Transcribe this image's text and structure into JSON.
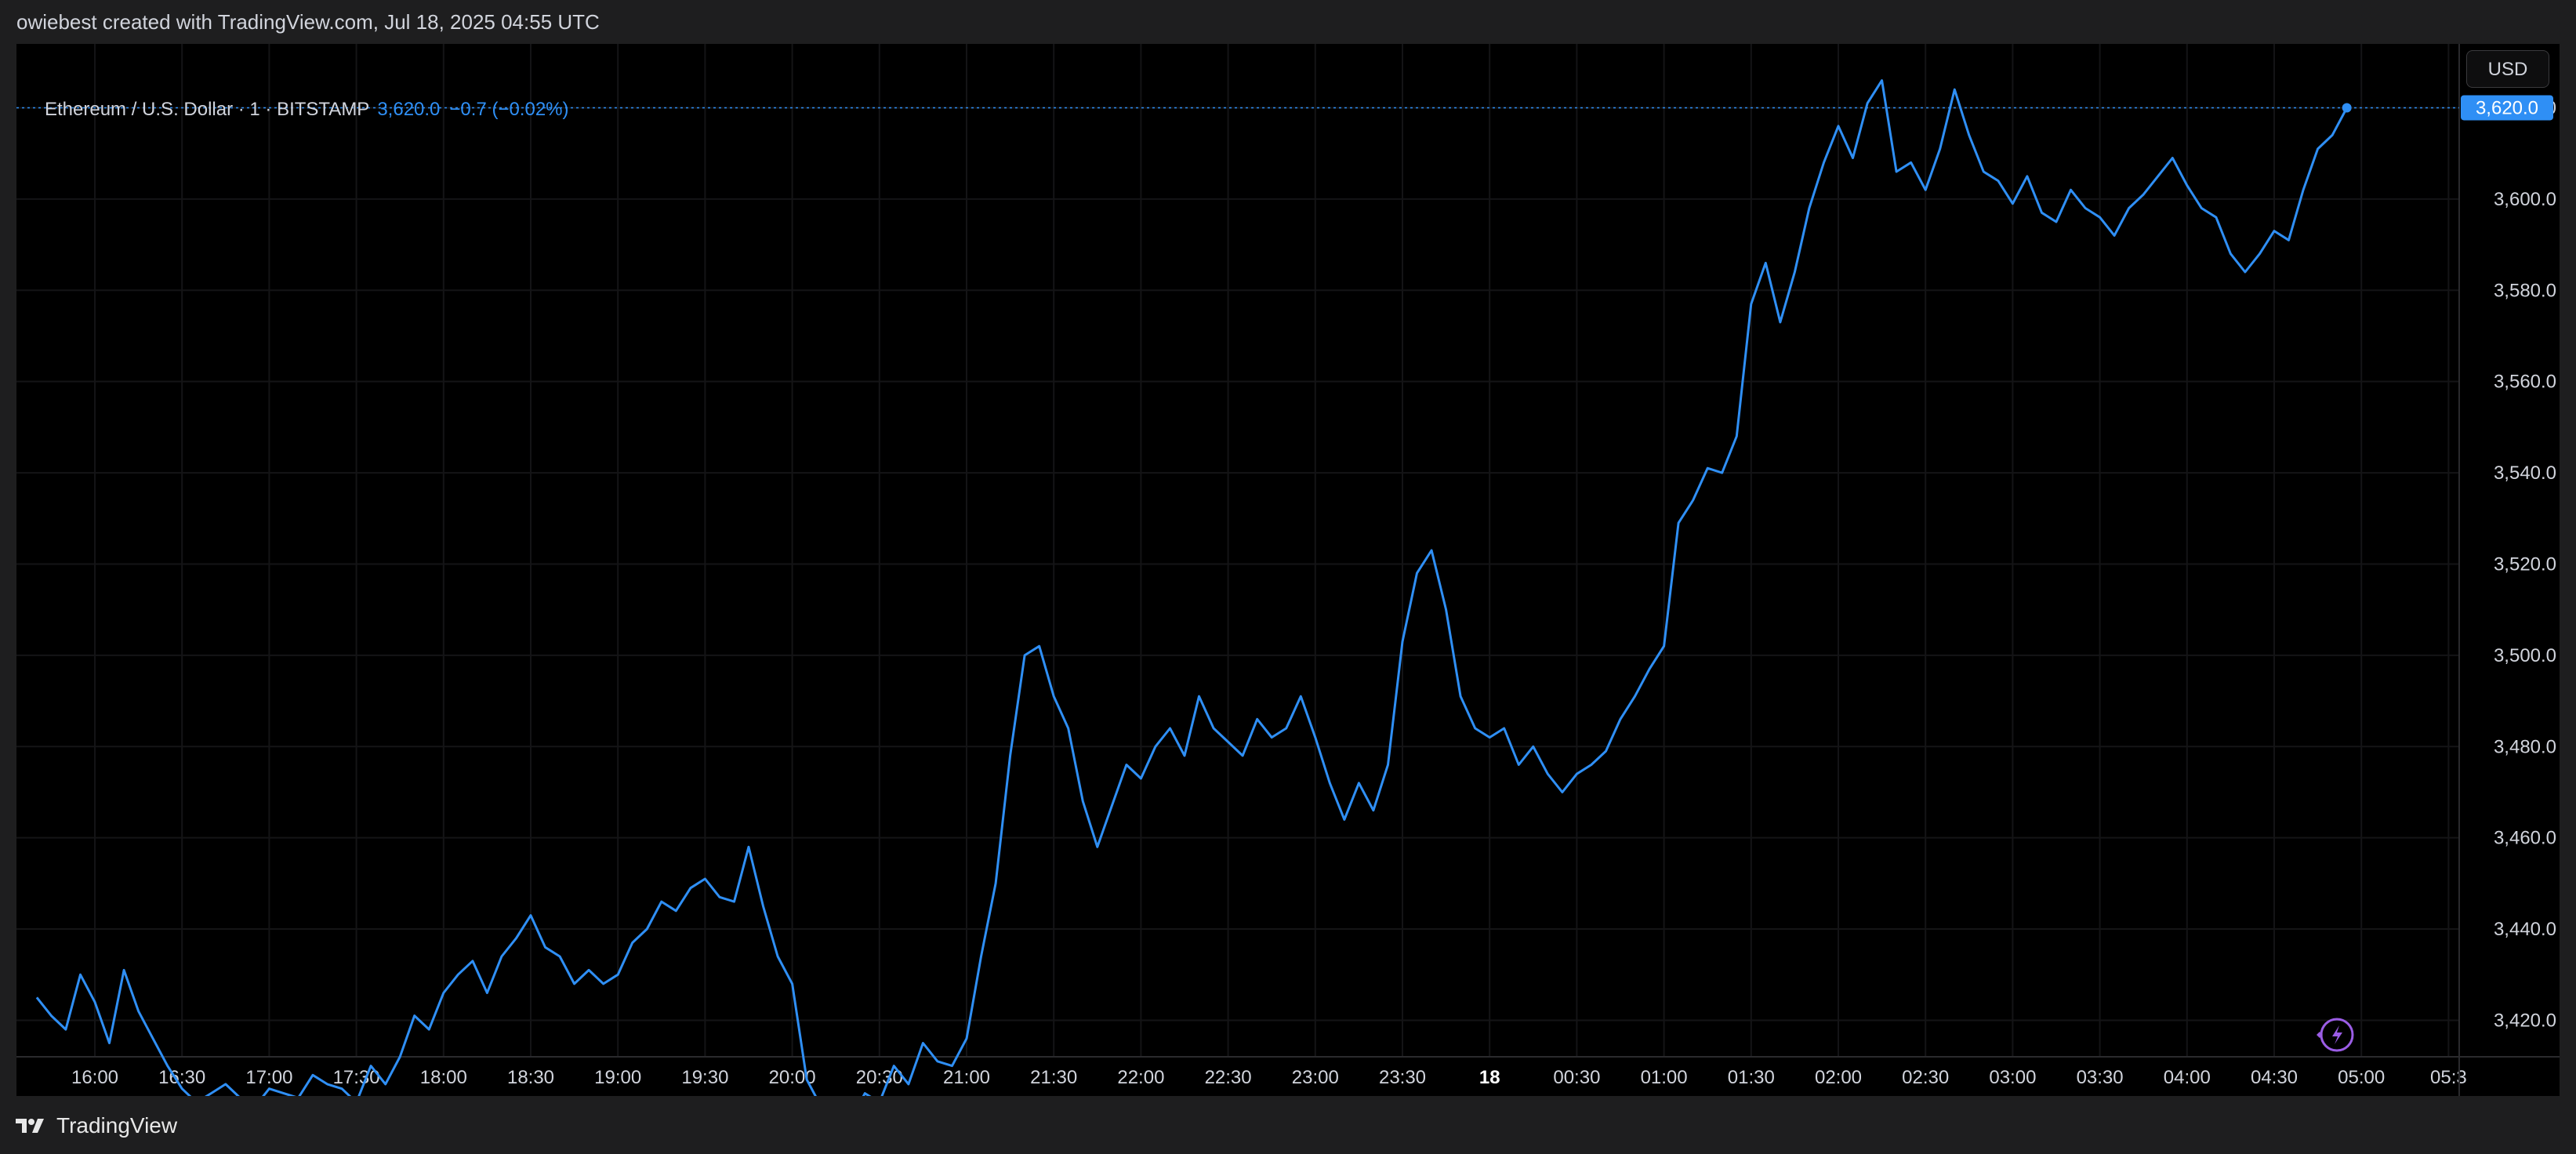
{
  "header": {
    "credit": "owiebest created with TradingView.com, Jul 18, 2025 04:55 UTC"
  },
  "legend": {
    "symbol": "Ethereum / U.S. Dollar · 1 · BITSTAMP",
    "last": "3,620.0",
    "change": "−0.7 (−0.02%)"
  },
  "currency_button": "USD",
  "footer": {
    "brand": "TradingView"
  },
  "colors": {
    "line": "#2f8ff5",
    "background": "#000000",
    "grid": "#141416",
    "text": "#d1d4dc",
    "price_tag": "#2f8ff5"
  },
  "icons": [
    "tradingview-logo-icon",
    "bolt-sparkle-icon"
  ],
  "chart_data": {
    "type": "line",
    "title": "Ethereum / U.S. Dollar · 1 · BITSTAMP",
    "series": [
      {
        "x": [
          "15:40",
          "15:45",
          "15:50",
          "15:55",
          "16:00",
          "16:05",
          "16:10",
          "16:15",
          "16:20",
          "16:25",
          "16:30",
          "16:35",
          "16:40",
          "16:45",
          "16:50",
          "16:55",
          "17:00",
          "17:05",
          "17:10",
          "17:15",
          "17:20",
          "17:25",
          "17:30",
          "17:35",
          "17:40",
          "17:45",
          "17:50",
          "17:55",
          "18:00",
          "18:05",
          "18:10",
          "18:15",
          "18:20",
          "18:25",
          "18:30",
          "18:35",
          "18:40",
          "18:45",
          "18:50",
          "18:55",
          "19:00",
          "19:05",
          "19:10",
          "19:15",
          "19:20",
          "19:25",
          "19:30",
          "19:35",
          "19:40",
          "19:45",
          "19:50",
          "19:55",
          "20:00",
          "20:05",
          "20:10",
          "20:15",
          "20:20",
          "20:25",
          "20:30",
          "20:35",
          "20:40",
          "20:45",
          "20:50",
          "20:55",
          "21:00",
          "21:05",
          "21:10",
          "21:15",
          "21:20",
          "21:25",
          "21:30",
          "21:35",
          "21:40",
          "21:45",
          "21:50",
          "21:55",
          "22:00",
          "22:05",
          "22:10",
          "22:15",
          "22:20",
          "22:25",
          "22:30",
          "22:35",
          "22:40",
          "22:45",
          "22:50",
          "22:55",
          "23:00",
          "23:05",
          "23:10",
          "23:15",
          "23:20",
          "23:25",
          "23:30",
          "23:35",
          "23:40",
          "23:45",
          "23:50",
          "23:55",
          "00:00",
          "00:05",
          "00:10",
          "00:15",
          "00:20",
          "00:25",
          "00:30",
          "00:35",
          "00:40",
          "00:45",
          "00:50",
          "00:55",
          "01:00",
          "01:05",
          "01:10",
          "01:15",
          "01:20",
          "01:25",
          "01:30",
          "01:35",
          "01:40",
          "01:45",
          "01:50",
          "01:55",
          "02:00",
          "02:05",
          "02:10",
          "02:15",
          "02:20",
          "02:25",
          "02:30",
          "02:35",
          "02:40",
          "02:45",
          "02:50",
          "02:55",
          "03:00",
          "03:05",
          "03:10",
          "03:15",
          "03:20",
          "03:25",
          "03:30",
          "03:35",
          "03:40",
          "03:45",
          "03:50",
          "03:55",
          "04:00",
          "04:05",
          "04:10",
          "04:15",
          "04:20",
          "04:25",
          "04:30",
          "04:35",
          "04:40",
          "04:45",
          "04:50",
          "04:55"
        ],
        "values": [
          3425,
          3421,
          3418,
          3430,
          3424,
          3415,
          3431,
          3422,
          3416,
          3410,
          3405,
          3402,
          3404,
          3406,
          3403,
          3401,
          3405,
          3404,
          3403,
          3408,
          3406,
          3405,
          3402,
          3410,
          3406,
          3412,
          3421,
          3418,
          3426,
          3430,
          3433,
          3426,
          3434,
          3438,
          3443,
          3436,
          3434,
          3428,
          3431,
          3428,
          3430,
          3437,
          3440,
          3446,
          3444,
          3449,
          3451,
          3447,
          3446,
          3458,
          3445,
          3434,
          3428,
          3407,
          3401,
          3396,
          3398,
          3404,
          3402,
          3410,
          3406,
          3415,
          3411,
          3410,
          3416,
          3434,
          3450,
          3478,
          3500,
          3502,
          3491,
          3484,
          3468,
          3458,
          3467,
          3476,
          3473,
          3480,
          3484,
          3478,
          3491,
          3484,
          3481,
          3478,
          3486,
          3482,
          3484,
          3491,
          3482,
          3472,
          3464,
          3472,
          3466,
          3476,
          3503,
          3518,
          3523,
          3510,
          3491,
          3484,
          3482,
          3484,
          3476,
          3480,
          3474,
          3470,
          3474,
          3476,
          3479,
          3486,
          3491,
          3497,
          3502,
          3529,
          3534,
          3541,
          3540,
          3548,
          3577,
          3586,
          3573,
          3584,
          3598,
          3608,
          3616,
          3609,
          3621,
          3626,
          3606,
          3608,
          3602,
          3611,
          3624,
          3614,
          3606,
          3604,
          3599,
          3605,
          3597,
          3595,
          3602,
          3598,
          3596,
          3592,
          3598,
          3601,
          3605,
          3609,
          3603,
          3598,
          3596,
          3588,
          3584,
          3588,
          3593,
          3591,
          3602,
          3611,
          3614,
          3620
        ],
        "color": "#2f8ff5"
      }
    ],
    "x_tick_labels": [
      "16:00",
      "16:30",
      "17:00",
      "17:30",
      "18:00",
      "18:30",
      "19:00",
      "19:30",
      "20:00",
      "20:30",
      "21:00",
      "21:30",
      "22:00",
      "22:30",
      "23:00",
      "23:30",
      "18",
      "00:30",
      "01:00",
      "01:30",
      "02:00",
      "02:30",
      "03:00",
      "03:30",
      "04:00",
      "04:30",
      "05:00",
      "05:3"
    ],
    "y_tick_labels": [
      "3,420.0",
      "3,440.0",
      "3,460.0",
      "3,480.0",
      "3,500.0",
      "3,520.0",
      "3,540.0",
      "3,560.0",
      "3,580.0",
      "3,600.0",
      "3,620.0"
    ],
    "ylim": [
      3412,
      3634
    ],
    "last_value_label": "3,620.0",
    "grid": true,
    "legend_position": "top-left"
  }
}
